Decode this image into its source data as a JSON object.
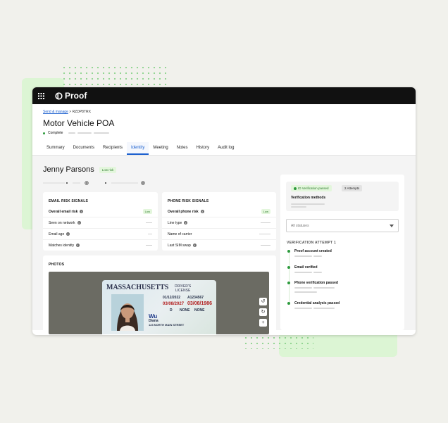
{
  "app": {
    "logo_text": "Proof"
  },
  "breadcrumb": {
    "link": "Send & manage",
    "separator": ">",
    "id": "RZDP8TRX"
  },
  "transaction": {
    "title": "Motor Vehicle POA",
    "status": "Complete"
  },
  "tabs": [
    {
      "label": "Summary"
    },
    {
      "label": "Documents"
    },
    {
      "label": "Recipients"
    },
    {
      "label": "Identity",
      "active": true
    },
    {
      "label": "Meeting"
    },
    {
      "label": "Notes"
    },
    {
      "label": "History"
    },
    {
      "label": "Audit log"
    }
  ],
  "person": {
    "name": "Jenny Parsons",
    "risk": "Low risk"
  },
  "email_signals": {
    "title": "EMAIL RISK SIGNALS",
    "rows": [
      {
        "label": "Overall email risk",
        "value": "Low"
      },
      {
        "label": "Seen on network"
      },
      {
        "label": "Email age"
      },
      {
        "label": "Matches identity"
      }
    ]
  },
  "phone_signals": {
    "title": "PHONE RISK SIGNALS",
    "rows": [
      {
        "label": "Overall phone risk",
        "value": "Low"
      },
      {
        "label": "Line type"
      },
      {
        "label": "Name of carrier"
      },
      {
        "label": "Last SIM swap"
      }
    ]
  },
  "photos": {
    "title": "PHOTOS",
    "id_card": {
      "state": "MASSACHUSETTS",
      "type_line1": "DRIVER'S",
      "type_line2": "LICENSE",
      "issue_date": "01/12/2022",
      "license_no": "A1234567",
      "exp_date": "03/08/2027",
      "dob": "03/08/1986",
      "last_name": "Wu",
      "first_name": "Diana",
      "address": "123 NORTH MAIN STREET",
      "class": "D",
      "restrictions": "NONE",
      "endorsements": "NONE"
    }
  },
  "verification": {
    "status_pill": "ID Verification passed",
    "attempts_pill": "2 Attempts",
    "methods_label": "Verification methods",
    "filter": "All statuses",
    "attempt_title": "VERIFICATION ATTEMPT 1",
    "steps": [
      {
        "label": "Proof account created"
      },
      {
        "label": "Email verified"
      },
      {
        "label": "Phone verification passed"
      },
      {
        "label": "Credential analysis passed"
      }
    ]
  },
  "colors": {
    "accent": "#1a5fcf",
    "success": "#2c9a3c",
    "success_bg": "#e3f6dc",
    "topbar": "#111111"
  }
}
